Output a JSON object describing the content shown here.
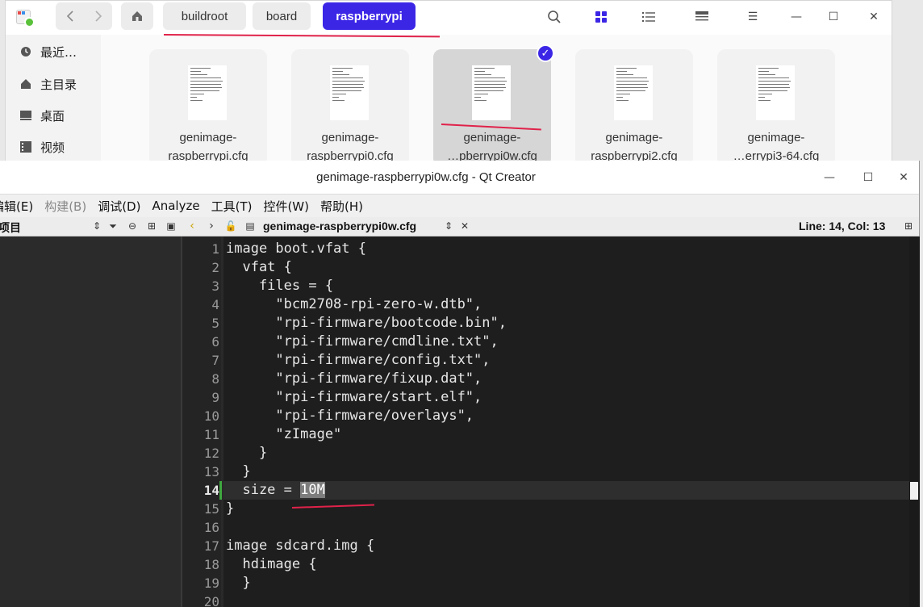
{
  "file_manager": {
    "breadcrumbs": [
      {
        "label": "buildroot",
        "active": false
      },
      {
        "label": "board",
        "active": false
      },
      {
        "label": "raspberrypi",
        "active": true
      }
    ],
    "sidebar": [
      {
        "label": "最近…",
        "icon": "clock-icon"
      },
      {
        "label": "主目录",
        "icon": "home-icon"
      },
      {
        "label": "桌面",
        "icon": "desktop-icon"
      },
      {
        "label": "视频",
        "icon": "video-icon"
      }
    ],
    "files": [
      {
        "line1": "genimage-",
        "line2": "raspberrypi.cfg",
        "selected": false
      },
      {
        "line1": "genimage-",
        "line2": "raspberrypi0.cfg",
        "selected": false
      },
      {
        "line1": "genimage-",
        "line2": "…pberrypi0w.cfg",
        "selected": true
      },
      {
        "line1": "genimage-",
        "line2": "raspberrypi2.cfg",
        "selected": false
      },
      {
        "line1": "genimage-",
        "line2": "…errypi3-64.cfg",
        "selected": false
      }
    ],
    "accent_color": "#3c26e6",
    "annotation_color": "#e0224a"
  },
  "qt_creator": {
    "window_title": "genimage-raspberrypi0w.cfg - Qt Creator",
    "menu": [
      {
        "label": "编辑(E)",
        "dim": false
      },
      {
        "label": "构建(B)",
        "dim": true
      },
      {
        "label": "调试(D)",
        "dim": false
      },
      {
        "label": "Analyze",
        "dim": false
      },
      {
        "label": "工具(T)",
        "dim": false
      },
      {
        "label": "控件(W)",
        "dim": false
      },
      {
        "label": "帮助(H)",
        "dim": false
      }
    ],
    "project_label": "项目",
    "open_file": "genimage-raspberrypi0w.cfg",
    "cursor_position": "Line: 14, Col: 13",
    "current_line": 14,
    "selected_text": "10M",
    "code_lines": [
      "image boot.vfat {",
      "  vfat {",
      "    files = {",
      "      \"bcm2708-rpi-zero-w.dtb\",",
      "      \"rpi-firmware/bootcode.bin\",",
      "      \"rpi-firmware/cmdline.txt\",",
      "      \"rpi-firmware/config.txt\",",
      "      \"rpi-firmware/fixup.dat\",",
      "      \"rpi-firmware/start.elf\",",
      "      \"rpi-firmware/overlays\",",
      "      \"zImage\"",
      "    }",
      "  }",
      "  size = 10M",
      "}",
      "",
      "image sdcard.img {",
      "  hdimage {",
      "  }",
      ""
    ]
  }
}
